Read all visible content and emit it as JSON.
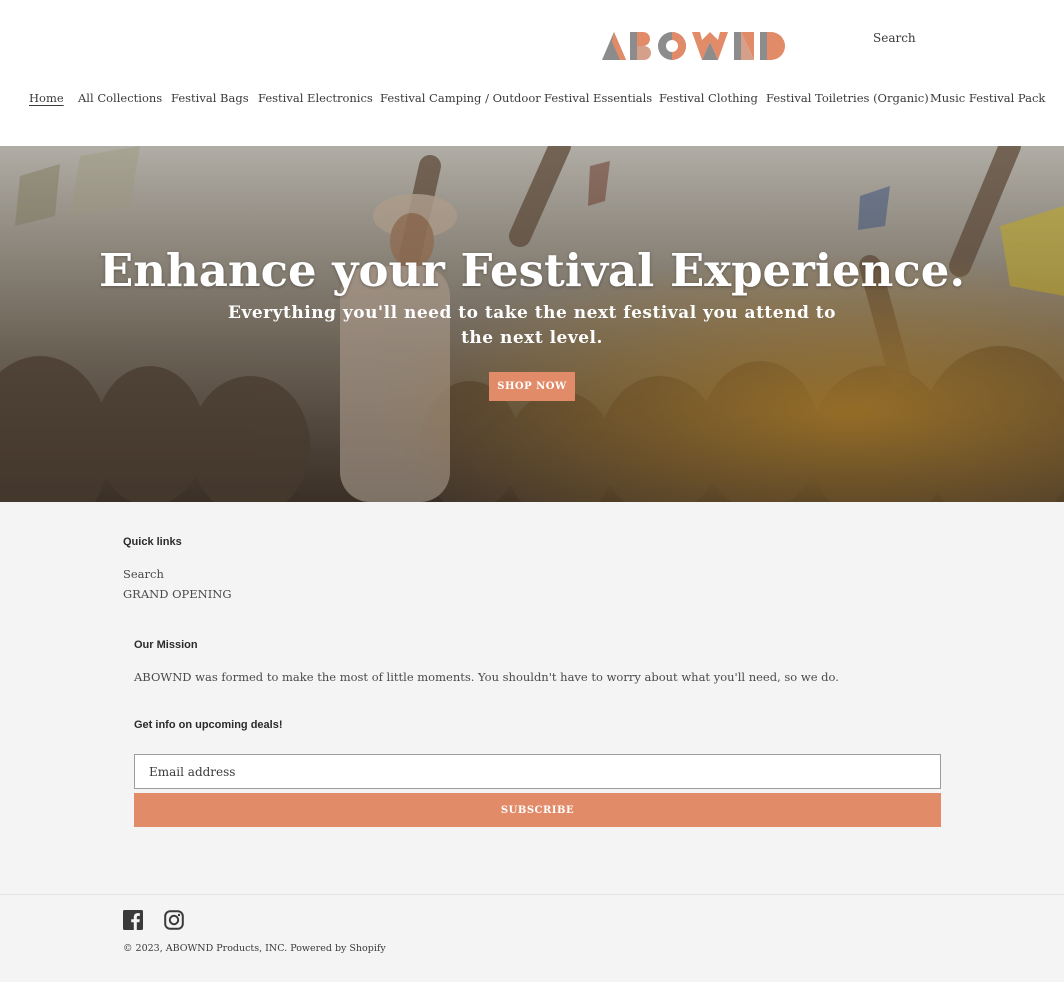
{
  "brand": {
    "logo_text": "ABOWND",
    "accent": "#e28b68",
    "logo_gray": "#8c8c8c"
  },
  "header": {
    "search_label": "Search",
    "nav": [
      {
        "label": "Home",
        "active": true
      },
      {
        "label": "All Collections"
      },
      {
        "label": "Festival Bags"
      },
      {
        "label": "Festival Electronics"
      },
      {
        "label": "Festival Camping / Outdoor"
      },
      {
        "label": "Festival Essentials"
      },
      {
        "label": "Festival Clothing"
      },
      {
        "label": "Festival Toiletries (Organic)"
      },
      {
        "label": "Music Festival Pack"
      }
    ]
  },
  "hero": {
    "title": "Enhance your Festival Experience.",
    "subtitle": "Everything you'll need to take the next festival you attend to the next level.",
    "button_label": "SHOP NOW"
  },
  "footer": {
    "quick_links_heading": "Quick links",
    "quick_links": [
      "Search",
      "GRAND OPENING"
    ],
    "mission_heading": "Our Mission",
    "mission_text": "ABOWND was formed to make the most of little moments. You shouldn't have to worry about what you'll need, so we do.",
    "newsletter_heading": "Get info on upcoming deals!",
    "email_placeholder": "Email address",
    "subscribe_label": "SUBSCRIBE",
    "social_icons": [
      "facebook-icon",
      "instagram-icon"
    ],
    "copyright": "© 2023, ABOWND Products, INC. Powered by Shopify"
  }
}
